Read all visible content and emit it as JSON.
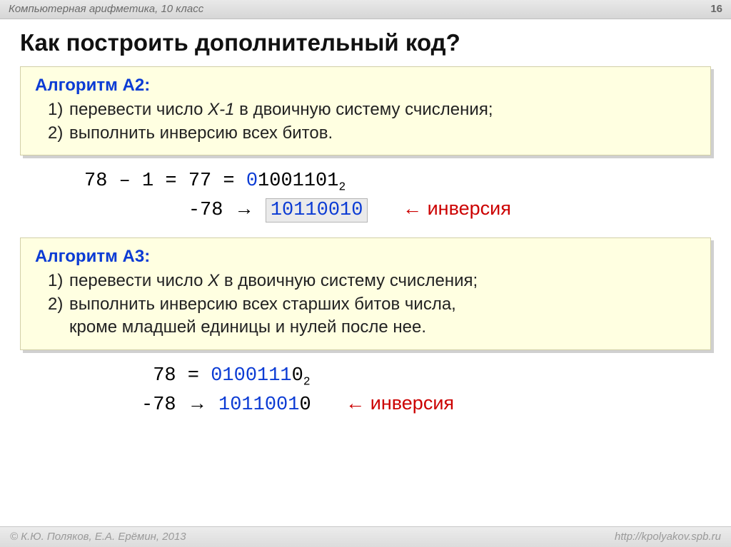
{
  "header": {
    "course": "Компьютерная арифметика, 10 класс",
    "page": "16"
  },
  "title": "Как построить дополнительный код?",
  "algo2": {
    "heading": "Алгоритм A2:",
    "n1": "1)",
    "l1a": "перевести число ",
    "l1var": "X-1",
    "l1b": " в двоичную систему счисления;",
    "n2": "2)",
    "l2": "выполнить инверсию всех битов."
  },
  "eq1": {
    "r1a": "78 – 1 = 77 = ",
    "r1_lead": "0",
    "r1_bin": "1001101",
    "r1_sub": "2",
    "r2a": "-78 ",
    "r2arrow": "→",
    "r2_res": "10110010",
    "inv_arrow": "←",
    "inv_label": " инверсия"
  },
  "algo3": {
    "heading": "Алгоритм A3:",
    "n1": "1)",
    "l1a": "перевести число ",
    "l1var": "X",
    "l1b": " в двоичную систему счисления;",
    "n2": "2)",
    "l2": "выполнить инверсию всех старших битов числа,",
    "l2cont": "кроме младшей единицы и нулей после нее."
  },
  "eq2": {
    "r1a": " 78 = ",
    "r1_blue1": "0100111",
    "r1_black": "0",
    "r1_sub": "2",
    "r2a": "-78 ",
    "r2arrow": "→",
    "r2_blue": "1011001",
    "r2_black": "0",
    "inv_arrow": "←",
    "inv_label": " инверсия"
  },
  "footer": {
    "left": "© К.Ю. Поляков, Е.А. Ерёмин, 2013",
    "right": "http://kpolyakov.spb.ru"
  }
}
